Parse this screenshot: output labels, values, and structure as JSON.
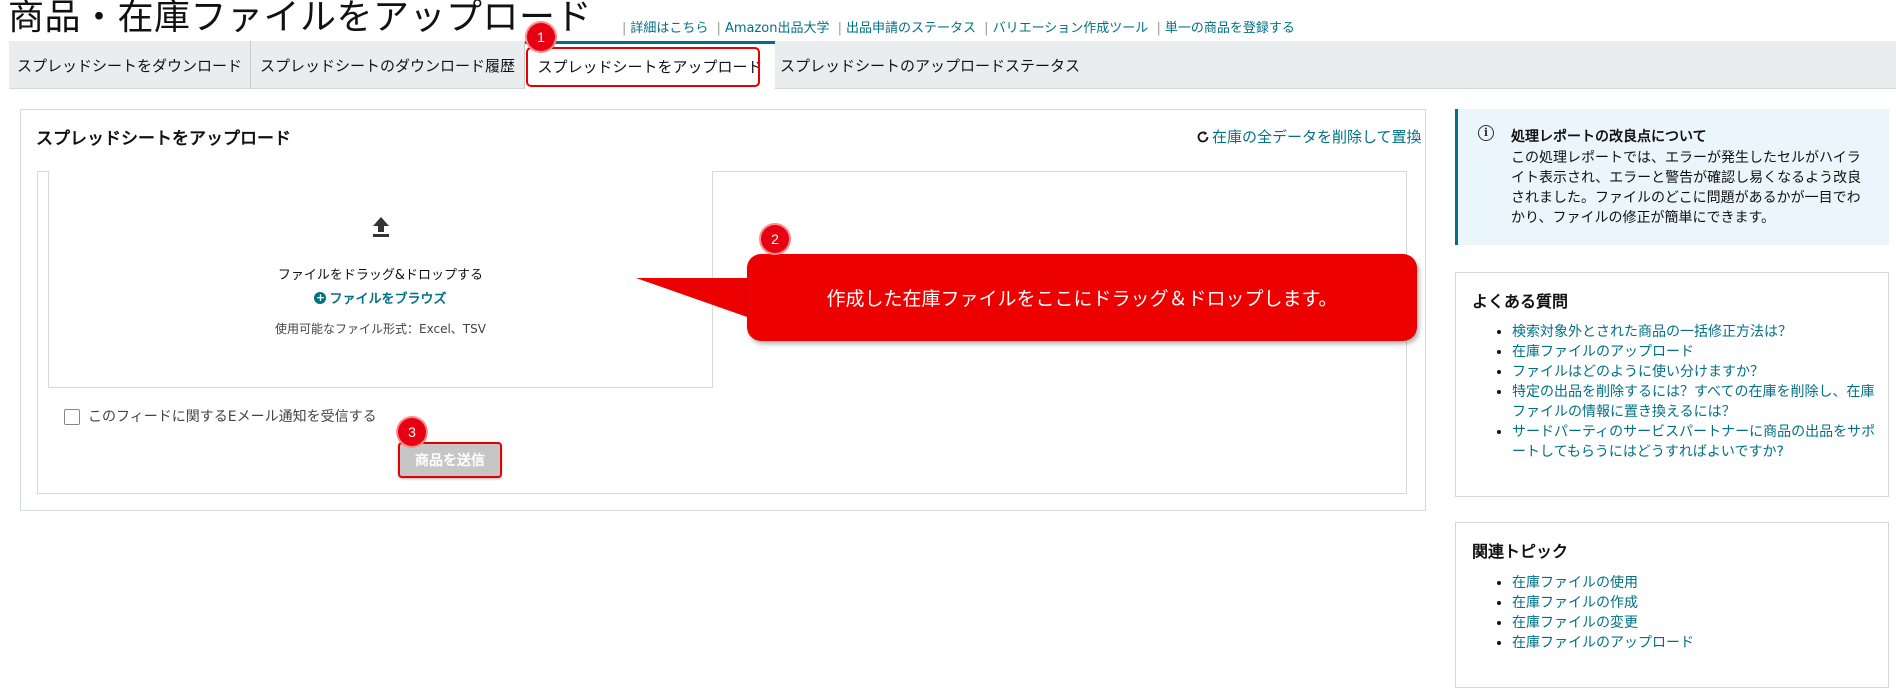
{
  "header": {
    "title": "商品・在庫ファイルをアップロード",
    "links": [
      "詳細はこちら",
      "Amazon出品大学",
      "出品申請のステータス",
      "バリエーション作成ツール",
      "単一の商品を登録する"
    ]
  },
  "tabs": [
    {
      "label": "スプレッドシートをダウンロード",
      "active": false
    },
    {
      "label": "スプレッドシートのダウンロード履歴",
      "active": false
    },
    {
      "label": "スプレッドシートをアップロード",
      "active": true
    },
    {
      "label": "スプレッドシートのアップロードステータス",
      "active": false
    }
  ],
  "main": {
    "heading": "スプレッドシートをアップロード",
    "replace_link": "在庫の全データを削除して置換",
    "drag_text": "ファイルをドラッグ&ドロップする",
    "browse_link": "ファイルをブラウズ",
    "formats": "使用可能なファイル形式：Excel、TSV",
    "email_label": "このフィードに関するEメール通知を受信する",
    "submit_label": "商品を送信"
  },
  "annotations": {
    "badges": [
      "1",
      "2",
      "3"
    ],
    "callout_text": "作成した在庫ファイルをここにドラッグ＆ドロップします。"
  },
  "side": {
    "info": {
      "title": "処理レポートの改良点について",
      "body": "この処理レポートでは、エラーが発生したセルがハイライト表示され、エラーと警告が確認し易くなるよう改良されました。ファイルのどこに問題があるかが一目でわかり、ファイルの修正が簡単にできます。"
    },
    "faq": {
      "title": "よくある質問",
      "items": [
        "検索対象外とされた商品の一括修正方法は？",
        "在庫ファイルのアップロード",
        "ファイルはどのように使い分けますか？",
        "特定の出品を削除するには？すべての在庫を削除し、在庫ファイルの情報に置き換えるには？",
        "サードパーティのサービスパートナーに商品の出品をサポートしてもらうにはどうすればよいですか?"
      ]
    },
    "related": {
      "title": "関連トピック",
      "items": [
        "在庫ファイルの使用",
        "在庫ファイルの作成",
        "在庫ファイルの変更",
        "在庫ファイルのアップロード"
      ]
    }
  },
  "colors": {
    "link": "#007185",
    "annotation_red": "#e60012",
    "tab_bar": "#eaeded",
    "info_bg": "#eaf6fb"
  },
  "icons": [
    "upload-icon",
    "plus-circle-icon",
    "refresh-icon",
    "info-icon"
  ]
}
